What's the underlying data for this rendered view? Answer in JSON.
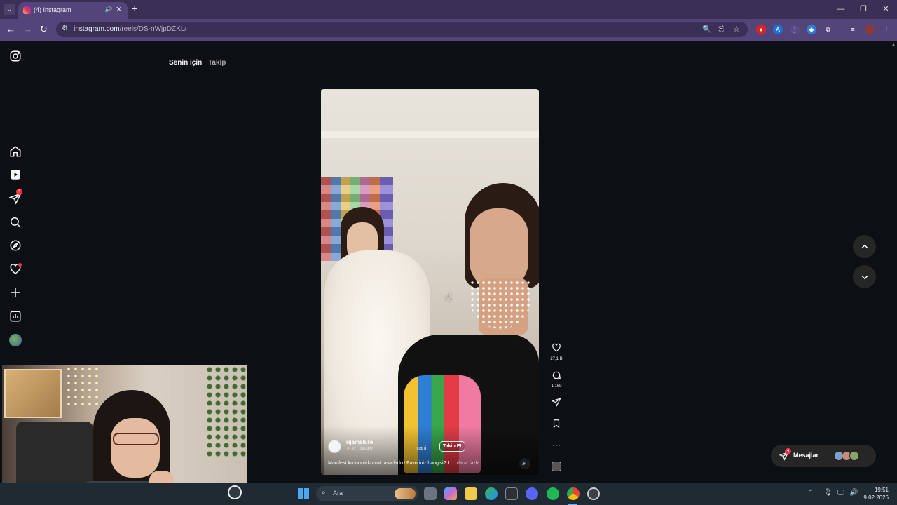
{
  "browser": {
    "tab_title": "(4) Instagram",
    "url_host": "instagram.com",
    "url_path": "/reels/DS-nWjpDZKL/"
  },
  "sidebar": {
    "notifications_badge": "4"
  },
  "feed": {
    "tab_for_you": "Senin için",
    "tab_following": "Takip"
  },
  "reel": {
    "author": "rijamelure",
    "author_sub": "↗ ·st · Amatör",
    "follow_label": "Takip Et",
    "overlay_text": "mani",
    "caption": "Manifest kızlarına kravat tasarladık! Favoriniz hangisi? 1 ...",
    "caption_more": "daha fazla",
    "likes": "27,1 B",
    "comments": "1.169"
  },
  "messages": {
    "label": "Mesajlar",
    "badge": "4"
  },
  "taskbar": {
    "search_label": "Ara",
    "time": "19:51",
    "date": "9.02.2026"
  },
  "colors": {
    "chrome_tab_bar": "#3b2f55",
    "chrome_toolbar": "#53447a",
    "ig_background": "#0c1014",
    "badge_red": "#ff3040",
    "taskbar": "#1f2a33"
  }
}
